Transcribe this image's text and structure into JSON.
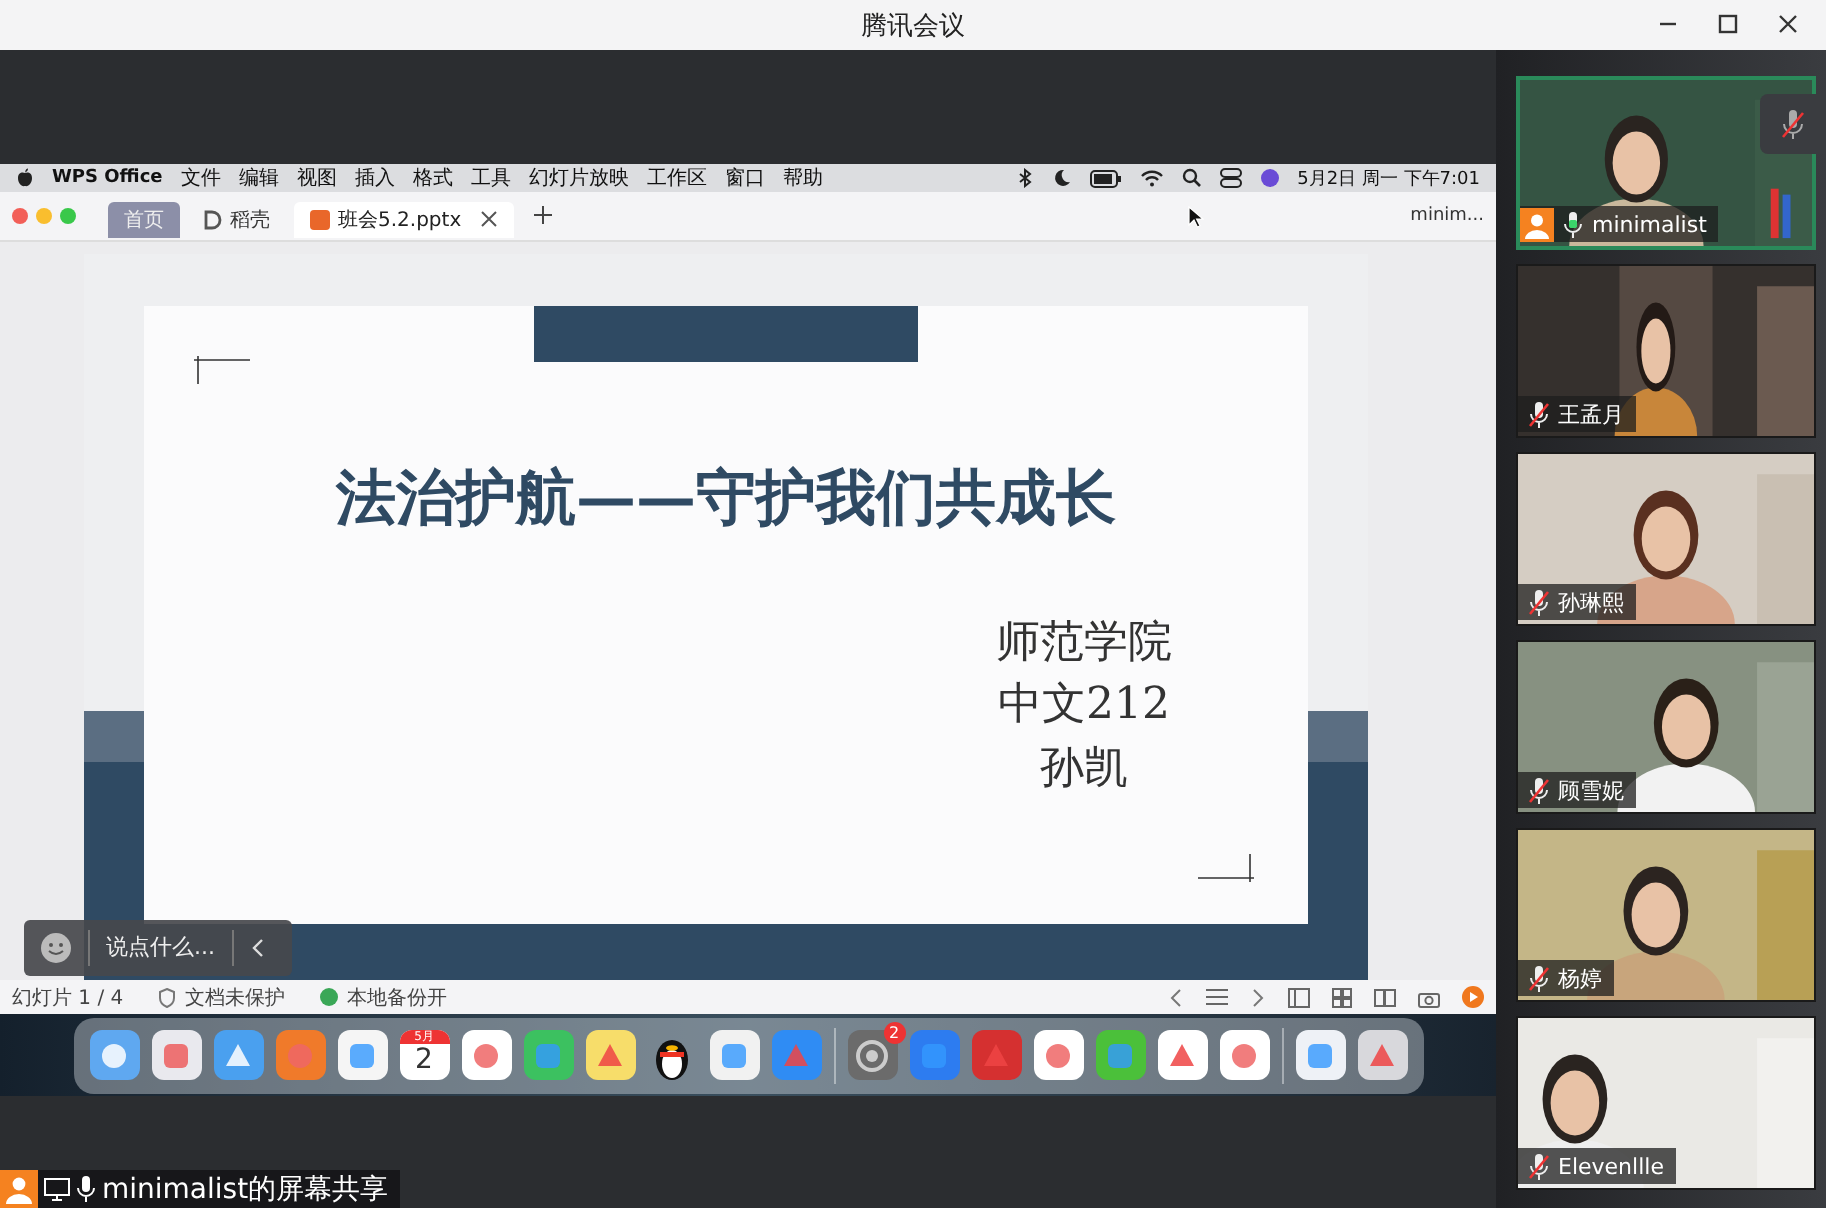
{
  "window": {
    "title": "腾讯会议"
  },
  "shared_screen": {
    "menu_bar": {
      "items": [
        "WPS Office",
        "文件",
        "编辑",
        "视图",
        "插入",
        "格式",
        "工具",
        "幻灯片放映",
        "工作区",
        "窗口",
        "帮助"
      ],
      "clock": "5月2日 周一 下午7:01"
    },
    "tabs": [
      {
        "label": "首页",
        "selected": false
      },
      {
        "label": "稻壳",
        "selected": false
      },
      {
        "label": "班会5.2.pptx",
        "selected": true
      }
    ],
    "account": "minim...",
    "slide": {
      "title": "法治护航——守护我们共成长",
      "lines": [
        "师范学院",
        "中文212",
        "孙凯"
      ]
    },
    "status_bar": {
      "page": "幻灯片 1 / 4",
      "protection": "文档未保护",
      "backup": "本地备份开"
    },
    "dock": {
      "calendar_month": "5月",
      "calendar_day": "2",
      "settings_badge": "2"
    }
  },
  "chat": {
    "placeholder": "说点什么..."
  },
  "share_label": "minimalist的屏幕共享",
  "participants": [
    {
      "name": "minimalist",
      "muted": false,
      "host": true,
      "selected": true
    },
    {
      "name": "王孟月",
      "muted": true,
      "host": false,
      "selected": false
    },
    {
      "name": "孙琳熙",
      "muted": true,
      "host": false,
      "selected": false
    },
    {
      "name": "顾雪妮",
      "muted": true,
      "host": false,
      "selected": false
    },
    {
      "name": "杨婷",
      "muted": true,
      "host": false,
      "selected": false
    },
    {
      "name": "Elevenllle",
      "muted": true,
      "host": false,
      "selected": false
    }
  ]
}
